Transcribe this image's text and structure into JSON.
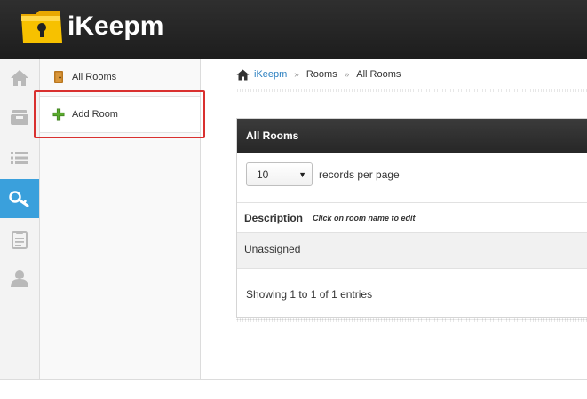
{
  "app": {
    "name": "iKeepm"
  },
  "rail": {
    "items": [
      {
        "icon": "home-icon"
      },
      {
        "icon": "inbox-icon"
      },
      {
        "icon": "list-icon"
      },
      {
        "icon": "key-icon",
        "active": true
      },
      {
        "icon": "clipboard-icon"
      },
      {
        "icon": "user-icon"
      }
    ]
  },
  "submenu": {
    "all_rooms": "All Rooms",
    "add_room": "Add Room"
  },
  "breadcrumb": {
    "home": "iKeepm",
    "level1": "Rooms",
    "level2": "All Rooms",
    "separator": "»"
  },
  "panel": {
    "title": "All Rooms",
    "page_size": "10",
    "records_per_page": "records per page",
    "column_description": "Description",
    "column_hint": "Click on room name to edit",
    "rows": [
      "Unassigned"
    ],
    "showing": "Showing 1 to 1 of 1 entries"
  },
  "colors": {
    "header": "#262626",
    "active_rail": "#3aa0dc",
    "link": "#2a7fc0",
    "highlight": "#d9302f"
  }
}
